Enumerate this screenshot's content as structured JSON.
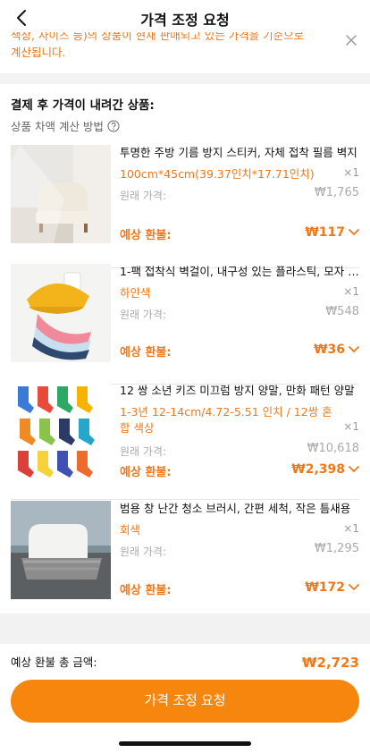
{
  "header": {
    "title": "가격 조정 요청"
  },
  "notice": {
    "line1": "색상, 사이즈 등)의 상품이 현재 판매되고 있는 가격을 기준으로",
    "line2": "계산됩니다."
  },
  "section": {
    "title": "결제 후 가격이 내려간 상품:",
    "calc_method": "상품 차액 계산 방법"
  },
  "labels": {
    "original_price": "원래 가격:",
    "expected_refund": "예상 환불:"
  },
  "items": [
    {
      "name": "투명한 주방 기름 방지 스티커, 자체 접착 필름 벽지",
      "variant": "100cm*45cm(39.37인치*17.71인치)",
      "qty": "×1",
      "original_price": "₩1,765",
      "refund": "₩117"
    },
    {
      "name": "1-팩 접착식 벽걸이, 내구성 있는 플라스틱, 모자 걸이",
      "variant": "하얀색",
      "qty": "×1",
      "original_price": "₩548",
      "refund": "₩36"
    },
    {
      "name": "12 쌍 소년 키즈 미끄럼 방지 양말, 만화 패턴 양말",
      "variant_line1": "1-3년 12-14cm/4.72-5.51 인치 / 12쌍 혼",
      "variant_line2": "합 색상",
      "qty": "×1",
      "original_price": "₩10,618",
      "refund": "₩2,398"
    },
    {
      "name": "범용 창 난간 청소 브러시, 간편 세척, 작은 틈새용",
      "variant": "회색",
      "qty": "×1",
      "original_price": "₩1,295",
      "refund": "₩172"
    }
  ],
  "footer": {
    "total_label": "예상 환불 총 금액:",
    "total_value": "₩2,723",
    "cta": "가격 조정 요청"
  },
  "colors": {
    "accent": "#f0781b",
    "button": "#f7860f",
    "band": "#f2f2f2"
  }
}
